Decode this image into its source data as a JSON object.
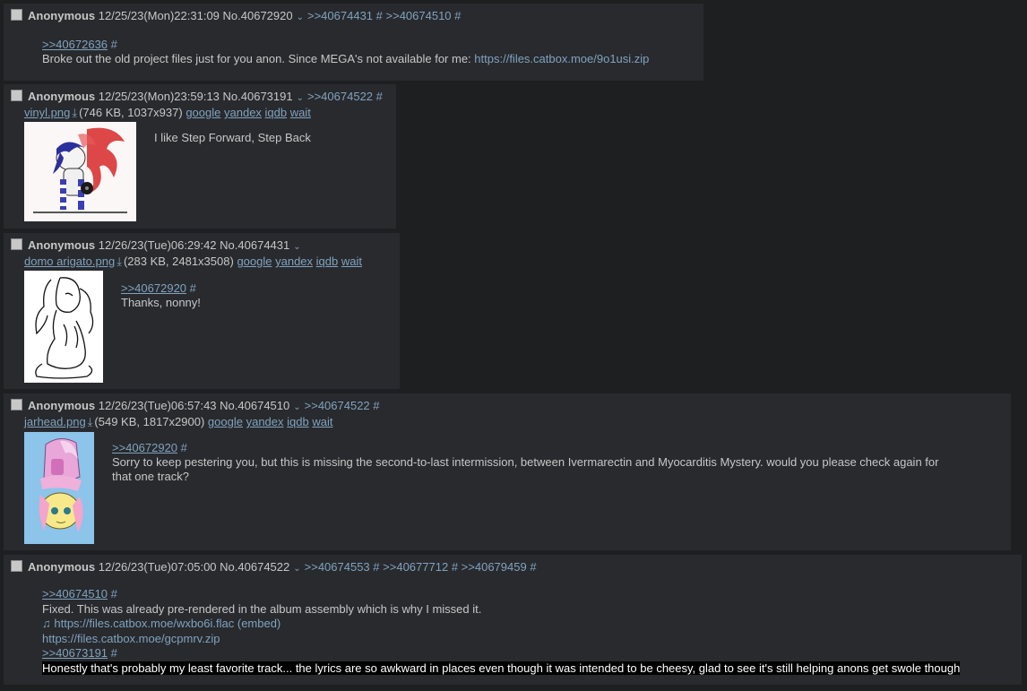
{
  "posts": [
    {
      "name": "Anonymous",
      "datetime": "12/25/23(Mon)22:31:09",
      "number": "No.40672920",
      "backlinks": [
        ">>40674431",
        ">>40674510"
      ],
      "reply_link": ">>40672636",
      "text_line": "Broke out the old project files just for you anon. Since MEGA's not available for me: ",
      "url": "https://files.catbox.moe/9o1usi.zip"
    },
    {
      "name": "Anonymous",
      "datetime": "12/25/23(Mon)23:59:13",
      "number": "No.40673191",
      "backlinks": [
        ">>40674522"
      ],
      "file_name": "vinyl.png",
      "file_meta": "(746 KB, 1037x937)",
      "search": [
        "google",
        "yandex",
        "iqdb",
        "wait"
      ],
      "text_line": "I like Step Forward, Step Back"
    },
    {
      "name": "Anonymous",
      "datetime": "12/26/23(Tue)06:29:42",
      "number": "No.40674431",
      "file_name": "domo arigato.png",
      "file_meta": "(283 KB, 2481x3508)",
      "search": [
        "google",
        "yandex",
        "iqdb",
        "wait"
      ],
      "reply_link": ">>40672920",
      "text_line": "Thanks, nonny!"
    },
    {
      "name": "Anonymous",
      "datetime": "12/26/23(Tue)06:57:43",
      "number": "No.40674510",
      "backlinks": [
        ">>40674522"
      ],
      "file_name": "jarhead.png",
      "file_meta": "(549 KB, 1817x2900)",
      "search": [
        "google",
        "yandex",
        "iqdb",
        "wait"
      ],
      "reply_link": ">>40672920",
      "text_line": "Sorry to keep pestering you, but this is missing the second-to-last intermission, between Ivermarectin and Myocarditis Mystery. would you please check again for",
      "text_line2": "that one track?"
    },
    {
      "name": "Anonymous",
      "datetime": "12/26/23(Tue)07:05:00",
      "number": "No.40674522",
      "backlinks": [
        ">>40674553",
        ">>40677712",
        ">>40679459"
      ],
      "reply_link": ">>40674510",
      "text_line": "Fixed. This was already pre-rendered in the album assembly which is why I missed it.",
      "audio_url": "https://files.catbox.moe/wxbo6i.flac (embed)",
      "zip_url": "https://files.catbox.moe/gcpmrv.zip",
      "reply_link2": ">>40673191",
      "highlighted": "Honestly that's probably my least favorite track... the lyrics are so awkward in places even though it was intended to be cheesy, glad to see it's still helping anons get swole though"
    }
  ],
  "ui": {
    "hash": "#",
    "chevron": "⌄",
    "download": "⤓",
    "music": "♫"
  }
}
